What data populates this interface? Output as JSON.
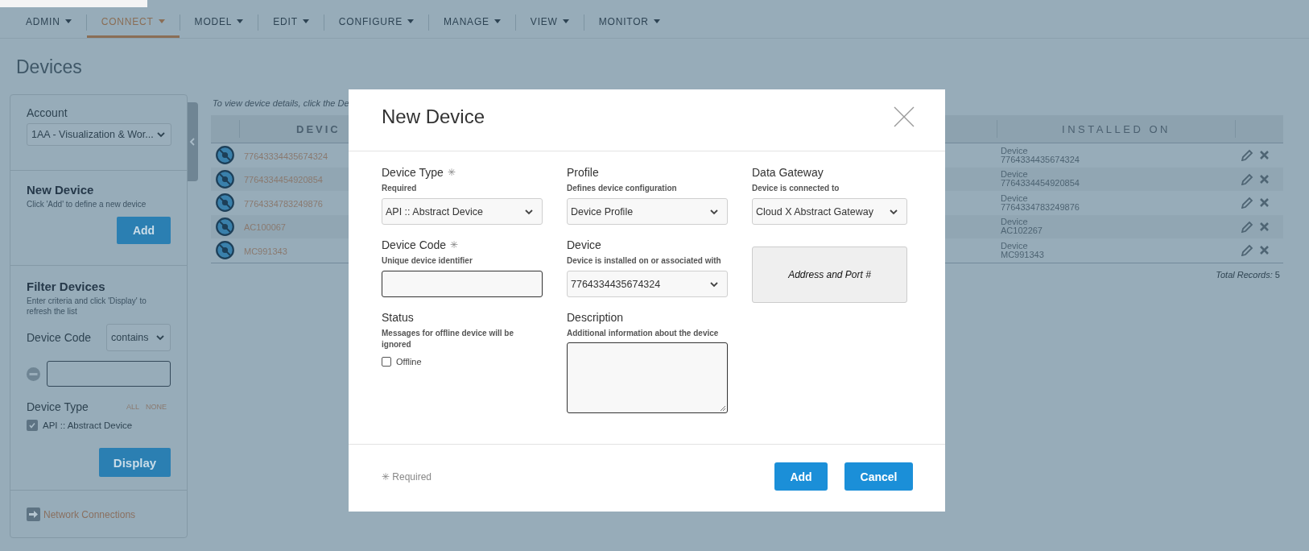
{
  "nav": {
    "items": [
      {
        "label": "ADMIN",
        "selected": false
      },
      {
        "label": "CONNECT",
        "selected": true
      },
      {
        "label": "MODEL",
        "selected": false
      },
      {
        "label": "EDIT",
        "selected": false
      },
      {
        "label": "CONFIGURE",
        "selected": false
      },
      {
        "label": "MANAGE",
        "selected": false
      },
      {
        "label": "VIEW",
        "selected": false
      },
      {
        "label": "MONITOR",
        "selected": false
      }
    ]
  },
  "page_title": "Devices",
  "sidebar": {
    "account": {
      "label": "Account",
      "value": "1AA - Visualization & Wor..."
    },
    "new_device": {
      "title": "New Device",
      "hint": "Click 'Add' to define a new device",
      "button": "Add"
    },
    "filter": {
      "title": "Filter Devices",
      "hint": "Enter criteria and click 'Display' to refresh the list",
      "device_code": {
        "label": "Device Code",
        "operator": "contains"
      },
      "device_type": {
        "label": "Device Type",
        "all": "ALL",
        "none": "NONE",
        "options": [
          {
            "label": "API :: Abstract Device",
            "checked": true
          }
        ]
      },
      "button": "Display"
    },
    "link": "Network Connections"
  },
  "table": {
    "hint": "To view device details, click the De",
    "columns": [
      "DEVIC",
      "INSTALLED ON"
    ],
    "rows": [
      {
        "code": "77643334435674324",
        "installed_type": "Device",
        "installed_code": "7764334435674324"
      },
      {
        "code": "7764334454920854",
        "installed_type": "Device",
        "installed_code": "7764334454920854"
      },
      {
        "code": "7764334783249876",
        "installed_type": "Device",
        "installed_code": "7764334783249876"
      },
      {
        "code": "AC100067",
        "installed_type": "Device",
        "installed_code": "AC102267"
      },
      {
        "code": "MC991343",
        "installed_type": "Device",
        "installed_code": "MC991343"
      }
    ],
    "total": "*Total Records:* 5"
  },
  "dialog": {
    "title": "New Device",
    "required_mark": "✳",
    "fields": [
      {
        "kind": "select",
        "label": "Device Type",
        "required": true,
        "hint": "Required",
        "value": "API :: Abstract Device"
      },
      {
        "kind": "select",
        "label": "Profile",
        "required": false,
        "hint": "Defines device configuration",
        "value": "Device Profile"
      },
      {
        "kind": "select",
        "label": "Data Gateway",
        "required": false,
        "hint": "Device is connected to",
        "value": "Cloud X Abstract Gateway"
      },
      {
        "kind": "input",
        "label": "Device Code",
        "required": true,
        "hint": "Unique device identifier"
      },
      {
        "kind": "select",
        "label": "Device",
        "required": false,
        "hint": "Device is installed on or associated with",
        "value": "7764334435674324"
      },
      {
        "kind": "panel",
        "text": "Address and Port #"
      },
      {
        "kind": "checkbox",
        "label": "Status",
        "required": false,
        "hint": "Messages for offline device will be ignored",
        "option": "Offline",
        "checked": false
      },
      {
        "kind": "textarea",
        "label": "Description",
        "required": false,
        "hint": "Additional information about the device"
      }
    ],
    "legend": "✳ Required",
    "buttons": [
      "Add",
      "Cancel"
    ]
  }
}
